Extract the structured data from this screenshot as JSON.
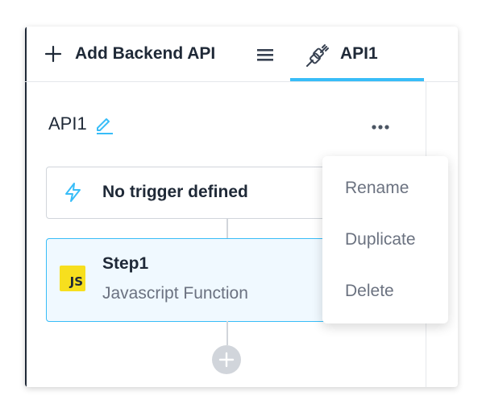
{
  "tabbar": {
    "add_label": "Add Backend API",
    "active_tab_label": "API1"
  },
  "editor": {
    "api_name": "API1",
    "trigger_label": "No trigger defined",
    "step": {
      "title": "Step1",
      "subtitle": "Javascript Function",
      "icon_text": "JS"
    }
  },
  "menu": {
    "items": [
      "Rename",
      "Duplicate",
      "Delete"
    ]
  },
  "colors": {
    "accent": "#38bdf8",
    "js_yellow": "#f7df1e",
    "step_background": "#f0f9ff"
  },
  "icons": [
    "plus-icon",
    "hamburger-menu-icon",
    "plug-icon",
    "pencil-icon",
    "more-dots-icon",
    "lightning-bolt-icon",
    "javascript-icon",
    "add-step-plus-icon"
  ]
}
